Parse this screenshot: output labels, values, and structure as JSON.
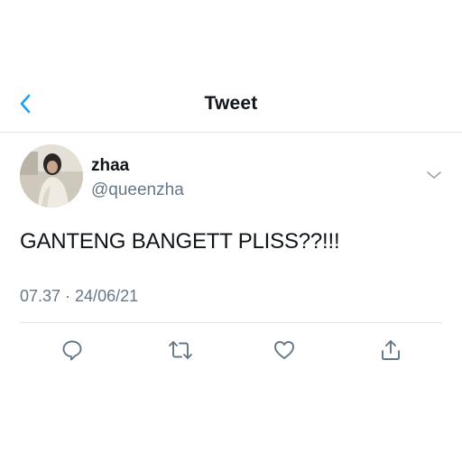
{
  "header": {
    "title": "Tweet",
    "back_icon": "chevron-left-icon",
    "accent_color": "#1da1f2"
  },
  "author": {
    "display_name": "zhaa",
    "handle": "@queenzha",
    "menu_icon": "chevron-down-icon"
  },
  "tweet": {
    "text": "GANTENG BANGETT PLISS??!!!",
    "timestamp": "07.37 · 24/06/21"
  },
  "actions": [
    {
      "name": "reply",
      "icon": "reply-icon"
    },
    {
      "name": "retweet",
      "icon": "retweet-icon"
    },
    {
      "name": "like",
      "icon": "heart-icon"
    },
    {
      "name": "share",
      "icon": "share-icon"
    }
  ],
  "colors": {
    "text": "#0f1419",
    "secondary": "#657786",
    "divider": "#e3e3e3"
  }
}
